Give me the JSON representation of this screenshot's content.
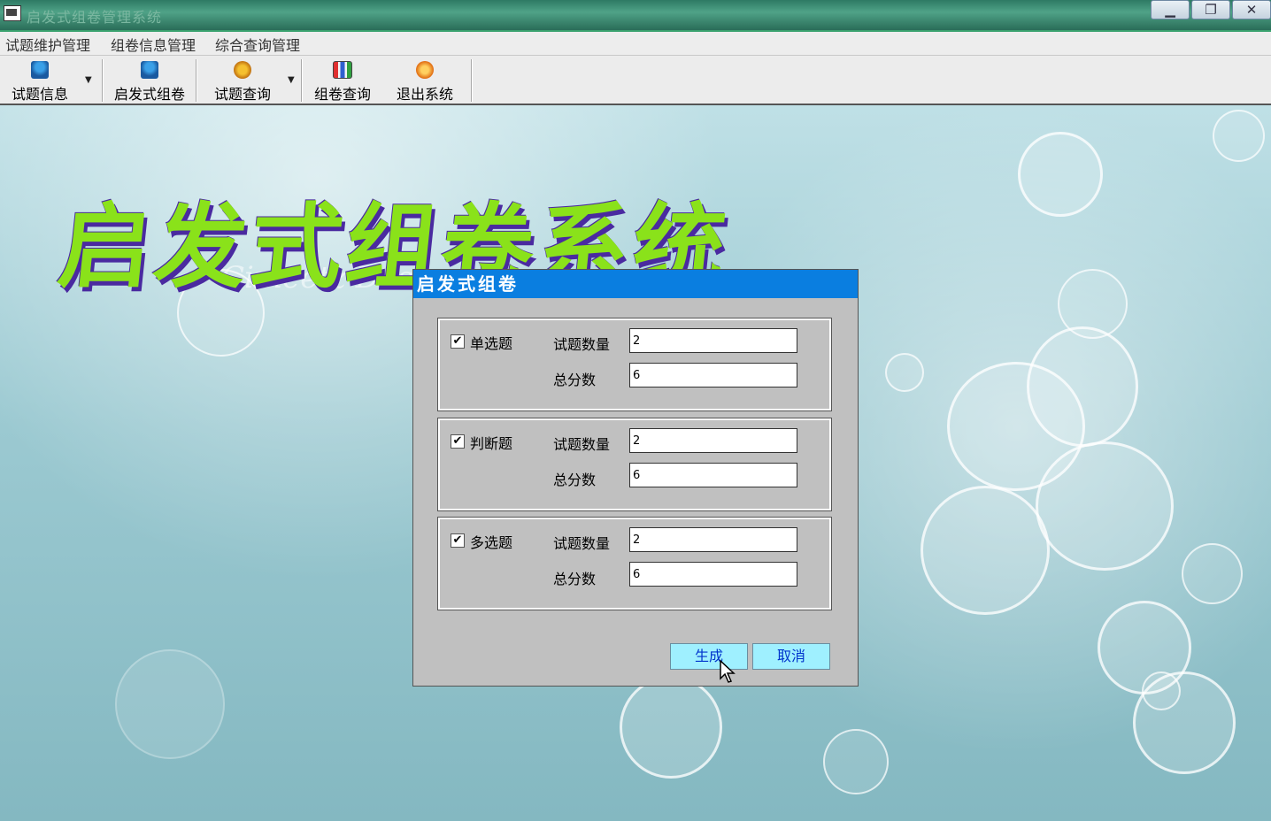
{
  "window": {
    "title": "启发式组卷管理系统",
    "controls": [
      "minimize-icon",
      "restore-icon",
      "close-icon"
    ]
  },
  "menu": [
    "试题维护管理",
    "组卷信息管理",
    "综合查询管理"
  ],
  "toolbar": [
    {
      "label": "试题信息",
      "icon": "user-icon",
      "dropdown": true
    },
    {
      "label": "启发式组卷",
      "icon": "user-icon",
      "dropdown": false
    },
    {
      "label": "试题查询",
      "icon": "gear-icon",
      "dropdown": true
    },
    {
      "label": "组卷查询",
      "icon": "chart-icon",
      "dropdown": false
    },
    {
      "label": "退出系统",
      "icon": "power-icon",
      "dropdown": false
    }
  ],
  "banner": {
    "text": "启发式组卷系统",
    "color": "#8ae21a",
    "shadow": "#4a2aa0"
  },
  "background": {
    "watermark": "Cimeetz Design"
  },
  "dialog": {
    "title": "启发式组卷",
    "sections": [
      {
        "type_label": "单选题",
        "checked": true,
        "count_label": "试题数量",
        "count_value": "2",
        "score_label": "总分数",
        "score_value": "6"
      },
      {
        "type_label": "判断题",
        "checked": true,
        "count_label": "试题数量",
        "count_value": "2",
        "score_label": "总分数",
        "score_value": "6"
      },
      {
        "type_label": "多选题",
        "checked": true,
        "count_label": "试题数量",
        "count_value": "2",
        "score_label": "总分数",
        "score_value": "6"
      }
    ],
    "generate_label": "生成",
    "cancel_label": "取消"
  },
  "colors": {
    "title_bar": "#0a7ee0",
    "button_bg": "#9ff0ff",
    "button_text": "#0033cc"
  }
}
